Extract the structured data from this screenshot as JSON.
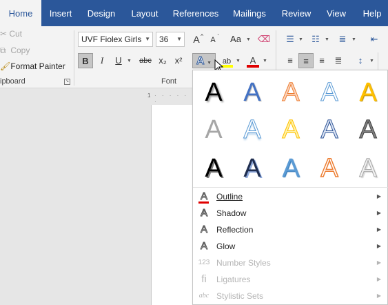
{
  "tabs": [
    {
      "label": "Home",
      "active": true
    },
    {
      "label": "Insert"
    },
    {
      "label": "Design"
    },
    {
      "label": "Layout"
    },
    {
      "label": "References"
    },
    {
      "label": "Mailings"
    },
    {
      "label": "Review"
    },
    {
      "label": "View"
    },
    {
      "label": "Help"
    }
  ],
  "clipboard": {
    "cut": "Cut",
    "copy": "Copy",
    "format_painter": "Format Painter",
    "group_label": "ipboard"
  },
  "font": {
    "name": "UVF Fiolex Girls",
    "size": "36",
    "group_label": "Font",
    "grow": "A",
    "shrink": "A",
    "change_case": "Aa",
    "bold": "B",
    "italic": "I",
    "underline": "U",
    "strikethrough": "abc",
    "subscript": "x₂",
    "superscript": "x²",
    "text_effects": "A",
    "highlight": "ab",
    "font_color": "A"
  },
  "ruler": {
    "mark": "1"
  },
  "effects_grid": [
    [
      "A",
      "A",
      "A",
      "A",
      "A"
    ],
    [
      "A",
      "A",
      "A",
      "A",
      "A"
    ],
    [
      "A",
      "A",
      "A",
      "A",
      "A"
    ]
  ],
  "effects_menu": [
    {
      "label": "Outline",
      "icon": "A",
      "disabled": false
    },
    {
      "label": "Shadow",
      "icon": "A",
      "disabled": false
    },
    {
      "label": "Reflection",
      "icon": "A",
      "disabled": false
    },
    {
      "label": "Glow",
      "icon": "A",
      "disabled": false
    },
    {
      "label": "Number Styles",
      "icon": "123",
      "disabled": true
    },
    {
      "label": "Ligatures",
      "icon": "fi",
      "disabled": true
    },
    {
      "label": "Stylistic Sets",
      "icon": "abc",
      "disabled": true
    }
  ],
  "colors": {
    "accent": "#2b579a",
    "font_color_bar": "#e00000",
    "highlight_bar": "#ffff00"
  }
}
